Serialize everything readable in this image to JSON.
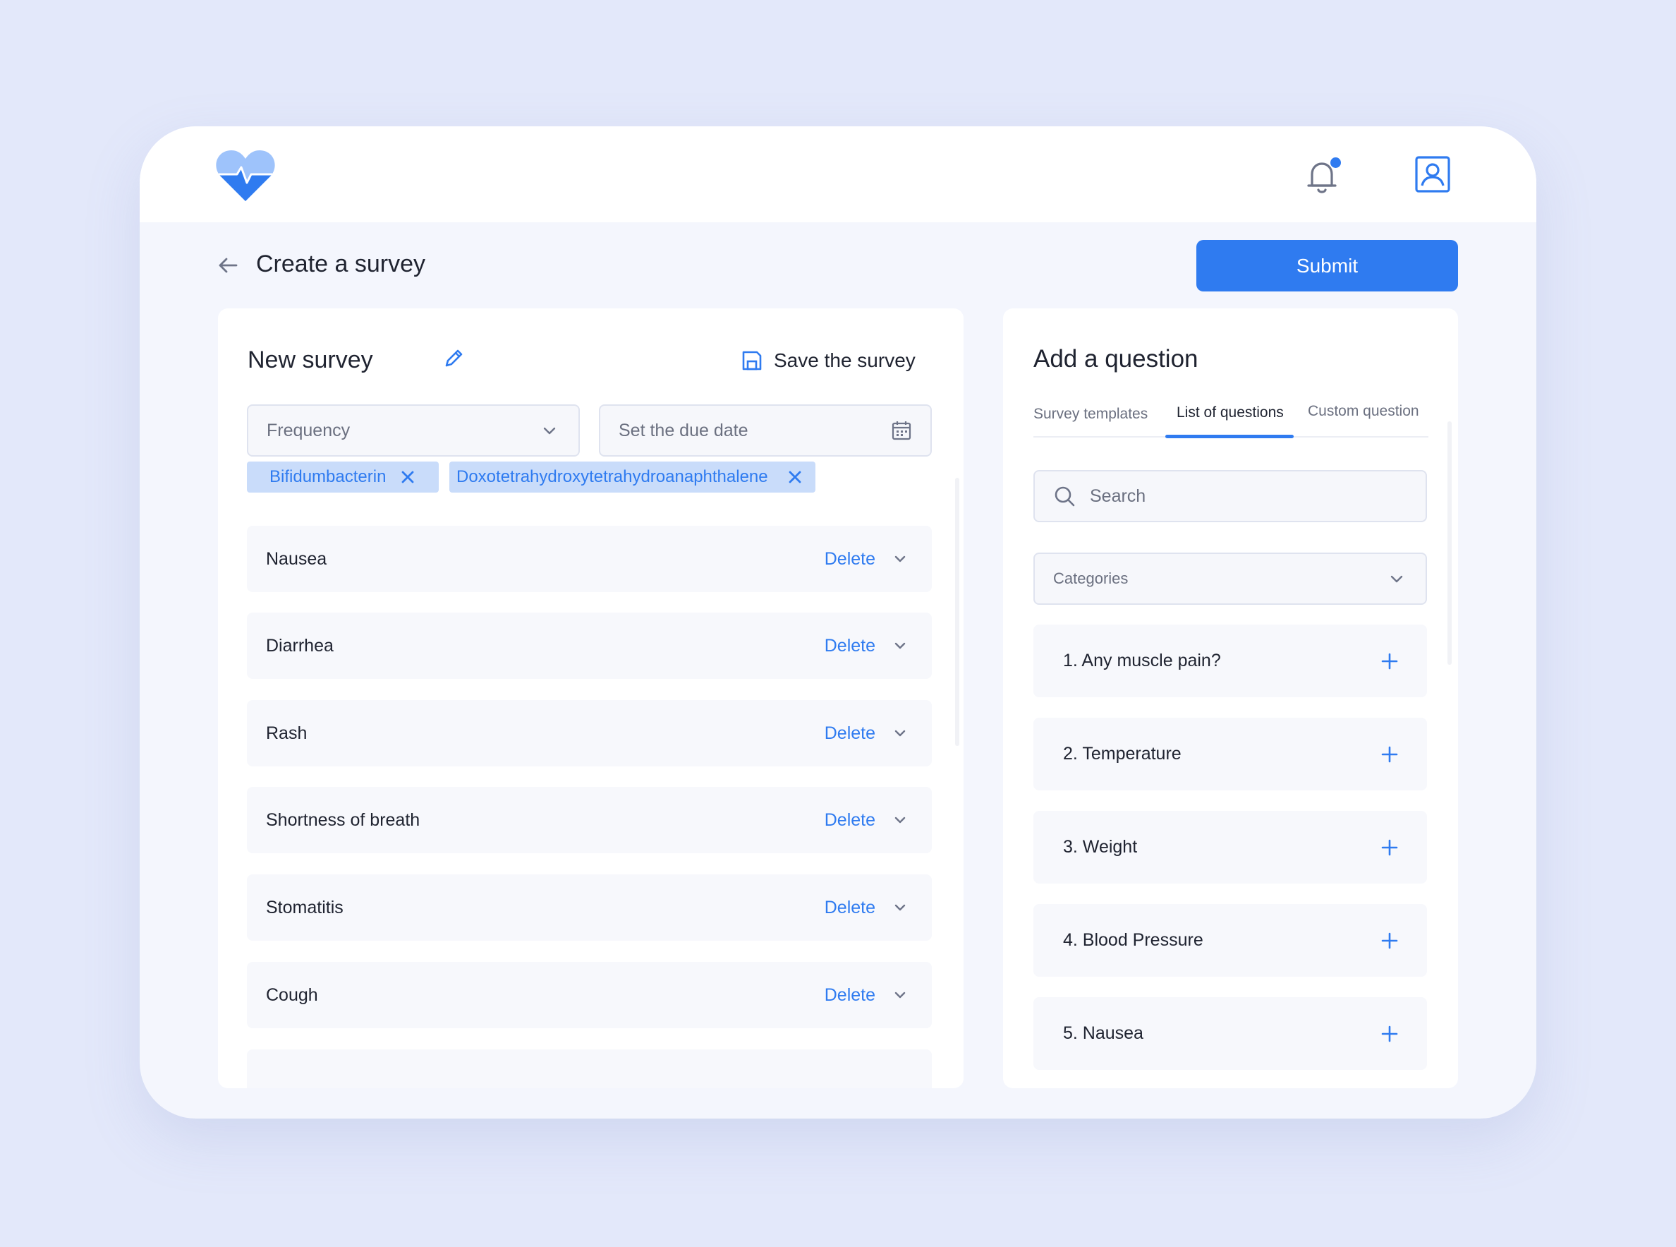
{
  "colors": {
    "accent": "#2f7bf0",
    "background": "#e3e8fa",
    "tag_bg": "#c9dcfa"
  },
  "header": {
    "title": "Create a survey",
    "submit_label": "Submit",
    "has_notification": true
  },
  "survey": {
    "name": "New survey",
    "save_label": "Save the survey",
    "frequency_placeholder": "Frequency",
    "due_date_placeholder": "Set the due date",
    "tags": [
      {
        "label": "Bifidumbacterin"
      },
      {
        "label": "Doxotetrahydroxytetrahydroanaphthalene"
      }
    ],
    "delete_label": "Delete",
    "items": [
      {
        "label": "Nausea"
      },
      {
        "label": "Diarrhea"
      },
      {
        "label": "Rash"
      },
      {
        "label": "Shortness of breath"
      },
      {
        "label": "Stomatitis"
      },
      {
        "label": "Cough"
      }
    ]
  },
  "add_question": {
    "title": "Add a question",
    "tabs": [
      {
        "label": "Survey templates",
        "active": false
      },
      {
        "label": "List of questions",
        "active": true
      },
      {
        "label": "Custom question",
        "active": false
      }
    ],
    "search_placeholder": "Search",
    "categories_placeholder": "Categories",
    "questions": [
      {
        "label": "1. Any muscle pain?"
      },
      {
        "label": "2. Temperature"
      },
      {
        "label": "3. Weight"
      },
      {
        "label": "4. Blood Pressure"
      },
      {
        "label": "5. Nausea"
      }
    ]
  },
  "icons": [
    "heart-logo-icon",
    "bell-icon",
    "profile-icon",
    "back-arrow-icon",
    "pencil-icon",
    "save-icon",
    "chevron-down-icon",
    "calendar-icon",
    "close-icon",
    "search-icon",
    "plus-icon"
  ]
}
